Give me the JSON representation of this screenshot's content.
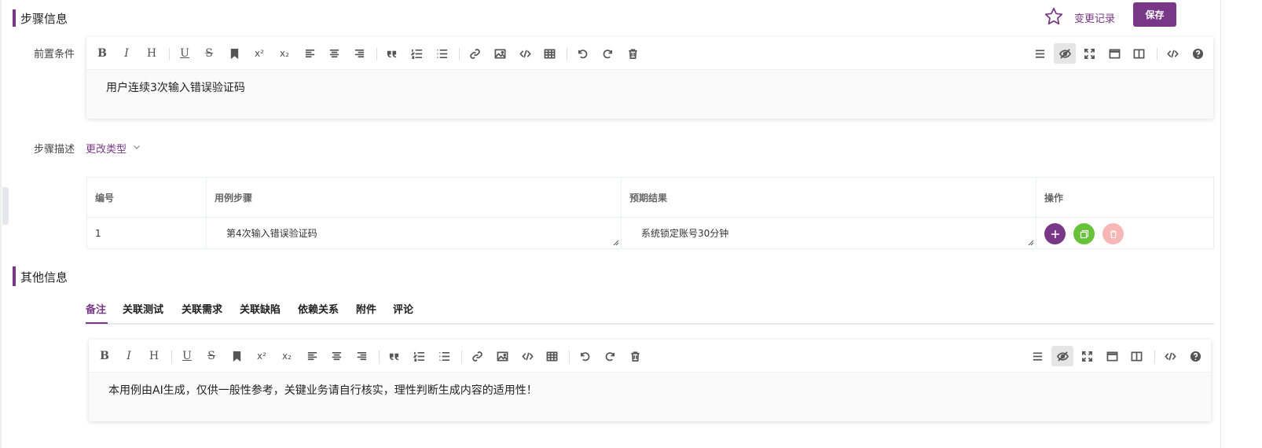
{
  "step_info": {
    "title": "步骤信息",
    "changelog": "变更记录",
    "save": "保存"
  },
  "precondition": {
    "label": "前置条件",
    "content": "用户连续3次输入错误验证码"
  },
  "step_desc": {
    "label": "步骤描述",
    "change_type": "更改类型"
  },
  "table": {
    "headers": [
      "编号",
      "用例步骤",
      "预期结果",
      "操作"
    ],
    "rows": [
      {
        "num": "1",
        "step": "第4次输入错误验证码",
        "expected": "系统锁定账号30分钟"
      }
    ]
  },
  "other_info": {
    "title": "其他信息",
    "tabs": [
      "备注",
      "关联测试",
      "关联需求",
      "关联缺陷",
      "依赖关系",
      "附件",
      "评论"
    ],
    "remark": "本用例由AI生成，仅供一般性参考，关键业务请自行核实，理性判断生成内容的适用性！"
  },
  "toolbar": {
    "bold": "B",
    "italic": "I",
    "heading": "H",
    "underline": "U",
    "strike": "S",
    "sup": "x²",
    "sub": "x₂"
  },
  "colors": {
    "accent": "#783887",
    "green": "#67c23a",
    "red_light": "#f7b7b7"
  }
}
